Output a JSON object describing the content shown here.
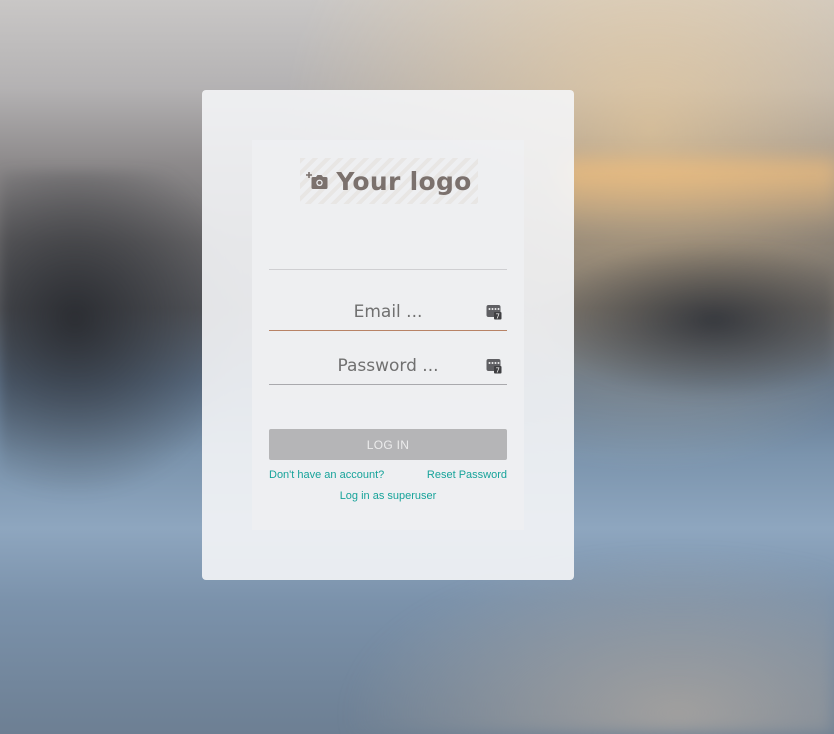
{
  "logo": {
    "text": "Your logo",
    "icon": "add-photo-icon",
    "text_color": "#7b716d"
  },
  "form": {
    "email": {
      "placeholder": "Email ...",
      "value": "",
      "icon": "password-manager-icon"
    },
    "password": {
      "placeholder": "Password ...",
      "value": "",
      "icon": "password-manager-icon"
    },
    "login_label": "LOG IN"
  },
  "links": {
    "signup": "Don't have an account?",
    "reset": "Reset Password",
    "superuser": "Log in as superuser"
  },
  "colors": {
    "accent": "#17a39a",
    "email_underline": "#b88366",
    "button_bg": "#b5b5b7"
  }
}
